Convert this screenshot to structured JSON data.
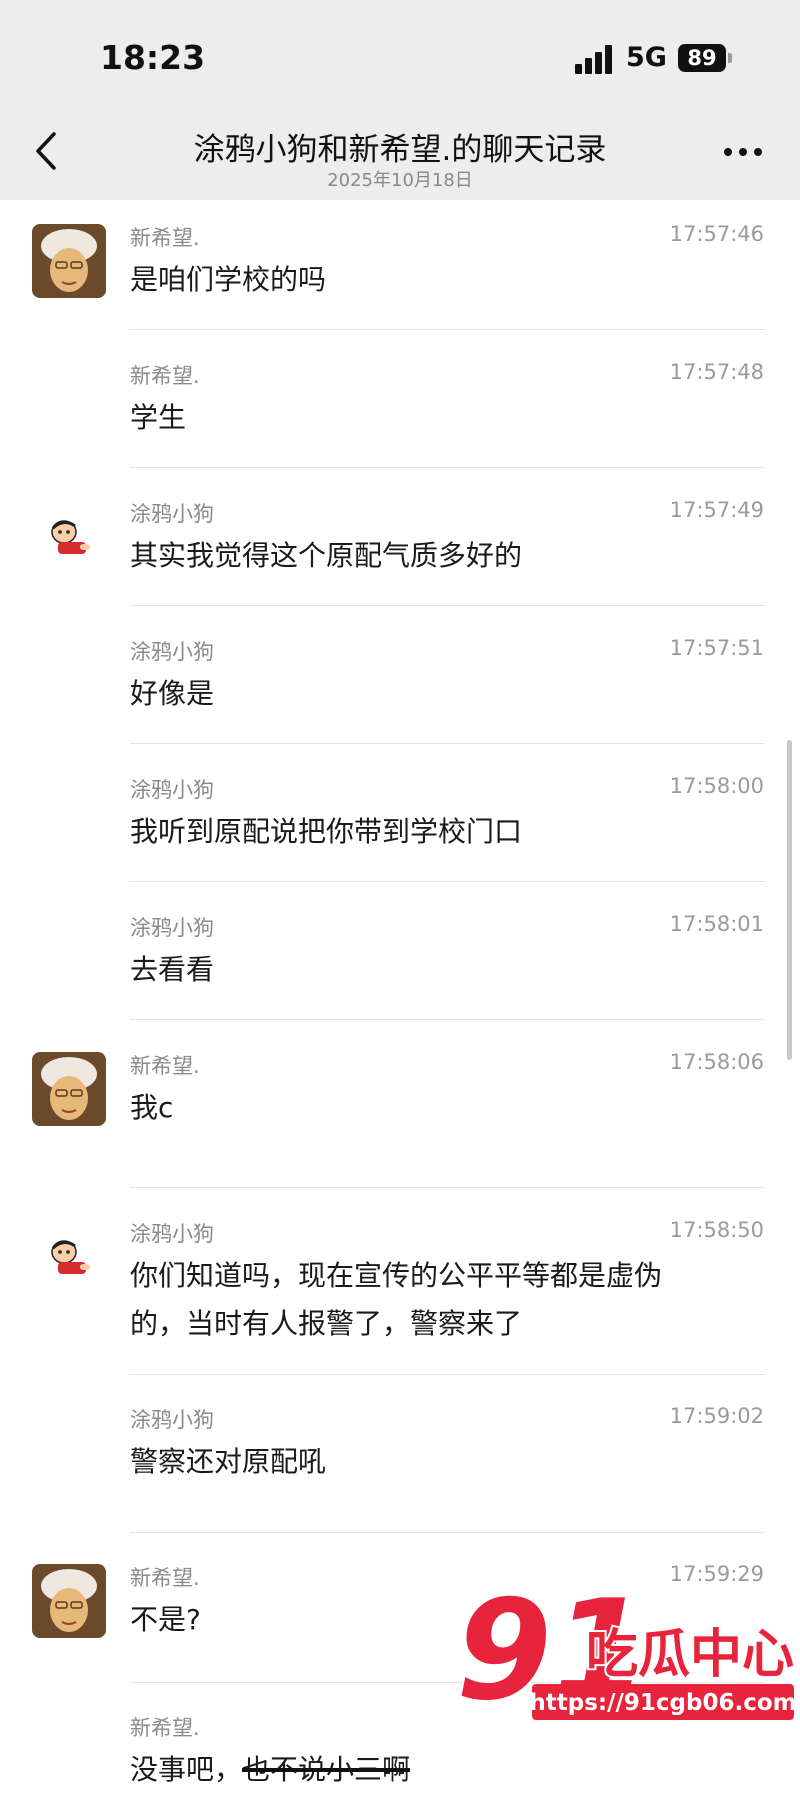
{
  "status_bar": {
    "time": "18:23",
    "network": "5G",
    "battery": "89"
  },
  "header": {
    "title": "涂鸦小狗和新希望.的聊天记录",
    "date": "2025年10月18日"
  },
  "messages": [
    {
      "sender": "新希望.",
      "time": "17:57:46",
      "text": "是咱们学校的吗",
      "avatar": "avatar-elder"
    },
    {
      "sender": "新希望.",
      "time": "17:57:48",
      "text": "学生"
    },
    {
      "sender": "涂鸦小狗",
      "time": "17:57:49",
      "text": "其实我觉得这个原配气质多好的",
      "avatar": "avatar-cartoon"
    },
    {
      "sender": "涂鸦小狗",
      "time": "17:57:51",
      "text": "好像是"
    },
    {
      "sender": "涂鸦小狗",
      "time": "17:58:00",
      "text": "我听到原配说把你带到学校门口"
    },
    {
      "sender": "涂鸦小狗",
      "time": "17:58:01",
      "text": "去看看"
    },
    {
      "sender": "新希望.",
      "time": "17:58:06",
      "text": "我c",
      "avatar": "avatar-elder"
    },
    {
      "sender": "涂鸦小狗",
      "time": "17:58:50",
      "text_line1": "你们知道吗，现在宣传的公平平等都是虚伪",
      "text_line2": "的，当时有人报警了，警察来了",
      "avatar": "avatar-cartoon"
    },
    {
      "sender": "涂鸦小狗",
      "time": "17:59:02",
      "text": "警察还对原配吼"
    },
    {
      "sender": "新希望.",
      "time": "17:59:29",
      "text": "不是?",
      "avatar": "avatar-elder"
    },
    {
      "sender": "新希望.",
      "time": "",
      "text": "没事吧，",
      "text_struck": "也不说小三啊"
    }
  ],
  "watermark": {
    "number": "91",
    "name": "吃瓜中心",
    "url": "https://91cgb06.com"
  },
  "colors": {
    "header_bg": "#ededed",
    "watermark_red": "#e8243c"
  }
}
